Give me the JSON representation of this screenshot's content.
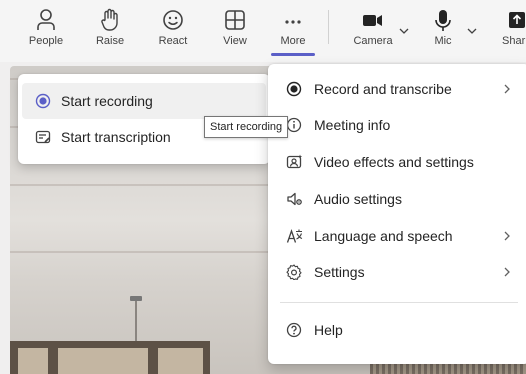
{
  "toolbar": {
    "people": "People",
    "raise": "Raise",
    "react": "React",
    "view": "View",
    "more": "More",
    "camera": "Camera",
    "mic": "Mic",
    "share": "Shar"
  },
  "recording_submenu": {
    "start_recording": "Start recording",
    "start_transcription": "Start transcription"
  },
  "tooltip": "Start recording",
  "more_menu": {
    "record_and_transcribe": "Record and transcribe",
    "meeting_info": "Meeting info",
    "video_effects": "Video effects and settings",
    "audio_settings": "Audio settings",
    "language_and_speech": "Language and speech",
    "settings": "Settings",
    "help": "Help"
  },
  "colors": {
    "accent": "#5b5fc7",
    "menu_bg": "#ffffff",
    "toolbar_bg": "#f5f5f5"
  },
  "icons": [
    "people-icon",
    "raise-hand-icon",
    "react-icon",
    "view-icon",
    "more-icon",
    "camera-icon",
    "mic-icon",
    "share-icon",
    "radio-record-icon",
    "transcript-icon",
    "video-effects-icon",
    "audio-settings-icon",
    "language-icon",
    "settings-gear-icon",
    "help-icon",
    "chevron-right-icon"
  ]
}
